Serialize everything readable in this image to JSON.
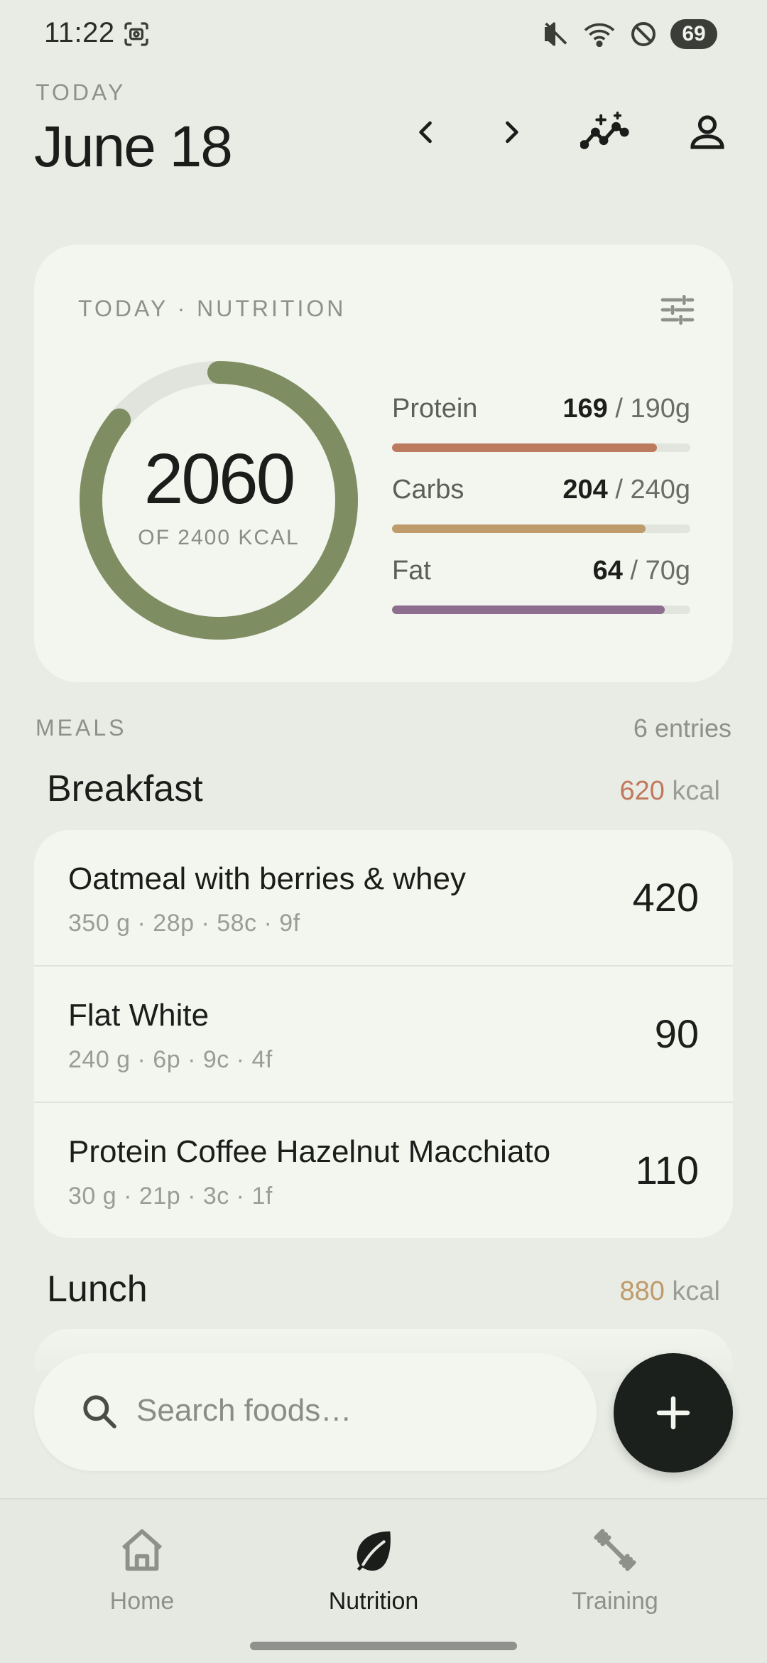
{
  "status_bar": {
    "time": "11:22",
    "battery": "69"
  },
  "header": {
    "overline": "TODAY",
    "title": "June 18"
  },
  "nutrition_card": {
    "label": "TODAY · NUTRITION",
    "calories_value": "2060",
    "calories_sub": "OF 2400 KCAL",
    "calories_progress": 0.858,
    "ring_color": "#7f8e62",
    "macros": [
      {
        "name": "Protein",
        "current": "169",
        "goal": "/ 190g",
        "progress": 0.889,
        "color": "#bc7a5e"
      },
      {
        "name": "Carbs",
        "current": "204",
        "goal": "/ 240g",
        "progress": 0.85,
        "color": "#bd9b6a"
      },
      {
        "name": "Fat",
        "current": "64",
        "goal": "/ 70g",
        "progress": 0.914,
        "color": "#8d6e8e"
      }
    ]
  },
  "meals": {
    "label": "MEALS",
    "entries": "6 entries",
    "breakfast": {
      "title": "Breakfast",
      "kcal_value": "620",
      "kcal_unit": "kcal",
      "kcal_color": "#c0795c",
      "items": [
        {
          "name": "Oatmeal with berries & whey",
          "meta": "350 g · 28p · 58c · 9f",
          "kcal": "420"
        },
        {
          "name": "Flat White",
          "meta": "240 g · 6p · 9c · 4f",
          "kcal": "90"
        },
        {
          "name": "Protein Coffee Hazelnut Macchiato",
          "meta": "30 g · 21p · 3c · 1f",
          "kcal": "110"
        }
      ]
    },
    "lunch": {
      "title": "Lunch",
      "kcal_value": "880",
      "kcal_unit": "kcal",
      "kcal_color": "#bd9b6a"
    }
  },
  "search": {
    "placeholder": "Search foods…"
  },
  "nav": {
    "items": [
      {
        "label": "Home",
        "icon": "home-icon"
      },
      {
        "label": "Nutrition",
        "icon": "leaf-icon",
        "active": true
      },
      {
        "label": "Training",
        "icon": "dumbbell-icon"
      }
    ]
  }
}
